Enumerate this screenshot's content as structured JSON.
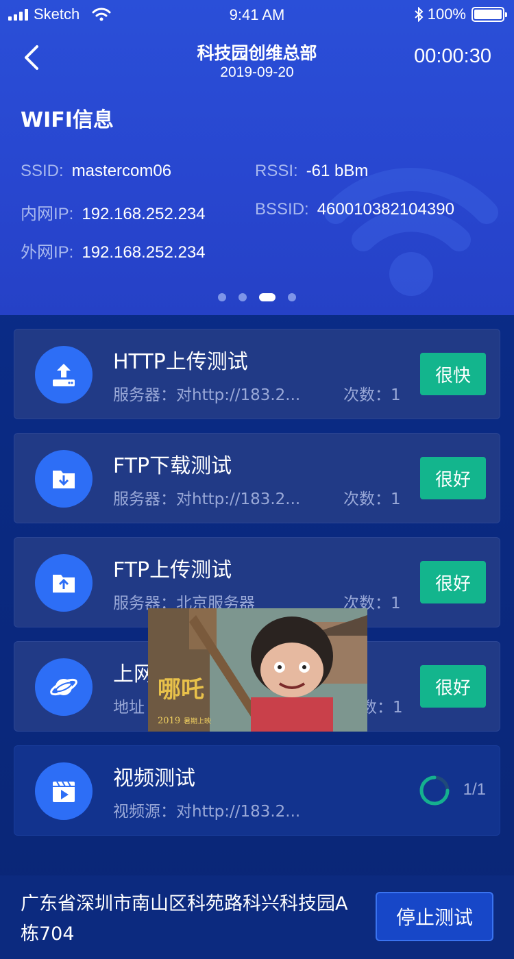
{
  "status_bar": {
    "carrier": "Sketch",
    "time": "9:41 AM",
    "battery": "100%"
  },
  "nav": {
    "title": "科技园创维总部",
    "date": "2019-09-20",
    "timer": "00:00:30"
  },
  "wifi": {
    "title": "WIFI信息",
    "ssid_label": "SSID:",
    "ssid_value": "mastercom06",
    "rssi_label": "RSSI:",
    "rssi_value": "-61 bBm",
    "lan_ip_label": "内网IP:",
    "lan_ip_value": "192.168.252.234",
    "bssid_label": "BSSID:",
    "bssid_value": "460010382104390",
    "wan_ip_label": "外网IP:",
    "wan_ip_value": "192.168.252.234"
  },
  "pager": {
    "count": 4,
    "active": 2
  },
  "tests": [
    {
      "title": "HTTP上传测试",
      "sub": "服务器：对http://183.2...",
      "count": "次数：1",
      "status": "很快",
      "icon": "upload-tray-icon"
    },
    {
      "title": "FTP下载测试",
      "sub": "服务器：对http://183.2...",
      "count": "次数：1",
      "status": "很好",
      "icon": "folder-download-icon"
    },
    {
      "title": "FTP上传测试",
      "sub": "服务器：北京服务器",
      "count": "次数：1",
      "status": "很好",
      "icon": "folder-upload-icon"
    },
    {
      "title": "上网",
      "sub": "地址",
      "count": "数：1",
      "status": "很好",
      "icon": "planet-icon"
    },
    {
      "title": "视频测试",
      "sub": "视频源：对http://183.2...",
      "progress": "1/1",
      "icon": "video-clapper-icon"
    }
  ],
  "overlay": {
    "poster_year": "2019",
    "poster_tagline": "暑期上映"
  },
  "bottom": {
    "address": "广东省深圳市南山区科苑路科兴科技园A栋704",
    "stop_label": "停止测试"
  },
  "colors": {
    "header_bg": "#2a4fd8",
    "page_bg": "#0b2d86",
    "card_bg": "#213a86",
    "icon_circle": "#2d6ef6",
    "badge_green": "#13b58d",
    "label_muted": "#9aa9d8"
  }
}
